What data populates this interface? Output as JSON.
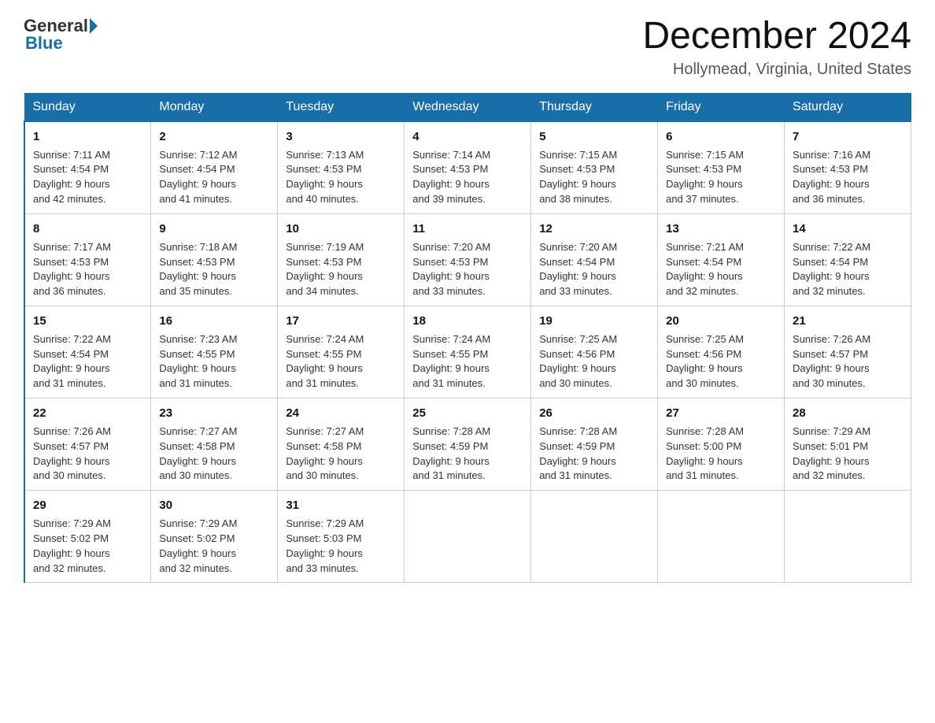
{
  "header": {
    "logo_general": "General",
    "logo_blue": "Blue",
    "month_title": "December 2024",
    "location": "Hollymead, Virginia, United States"
  },
  "days_of_week": [
    "Sunday",
    "Monday",
    "Tuesday",
    "Wednesday",
    "Thursday",
    "Friday",
    "Saturday"
  ],
  "weeks": [
    [
      {
        "day": "1",
        "sunrise": "7:11 AM",
        "sunset": "4:54 PM",
        "daylight": "9 hours and 42 minutes."
      },
      {
        "day": "2",
        "sunrise": "7:12 AM",
        "sunset": "4:54 PM",
        "daylight": "9 hours and 41 minutes."
      },
      {
        "day": "3",
        "sunrise": "7:13 AM",
        "sunset": "4:53 PM",
        "daylight": "9 hours and 40 minutes."
      },
      {
        "day": "4",
        "sunrise": "7:14 AM",
        "sunset": "4:53 PM",
        "daylight": "9 hours and 39 minutes."
      },
      {
        "day": "5",
        "sunrise": "7:15 AM",
        "sunset": "4:53 PM",
        "daylight": "9 hours and 38 minutes."
      },
      {
        "day": "6",
        "sunrise": "7:15 AM",
        "sunset": "4:53 PM",
        "daylight": "9 hours and 37 minutes."
      },
      {
        "day": "7",
        "sunrise": "7:16 AM",
        "sunset": "4:53 PM",
        "daylight": "9 hours and 36 minutes."
      }
    ],
    [
      {
        "day": "8",
        "sunrise": "7:17 AM",
        "sunset": "4:53 PM",
        "daylight": "9 hours and 36 minutes."
      },
      {
        "day": "9",
        "sunrise": "7:18 AM",
        "sunset": "4:53 PM",
        "daylight": "9 hours and 35 minutes."
      },
      {
        "day": "10",
        "sunrise": "7:19 AM",
        "sunset": "4:53 PM",
        "daylight": "9 hours and 34 minutes."
      },
      {
        "day": "11",
        "sunrise": "7:20 AM",
        "sunset": "4:53 PM",
        "daylight": "9 hours and 33 minutes."
      },
      {
        "day": "12",
        "sunrise": "7:20 AM",
        "sunset": "4:54 PM",
        "daylight": "9 hours and 33 minutes."
      },
      {
        "day": "13",
        "sunrise": "7:21 AM",
        "sunset": "4:54 PM",
        "daylight": "9 hours and 32 minutes."
      },
      {
        "day": "14",
        "sunrise": "7:22 AM",
        "sunset": "4:54 PM",
        "daylight": "9 hours and 32 minutes."
      }
    ],
    [
      {
        "day": "15",
        "sunrise": "7:22 AM",
        "sunset": "4:54 PM",
        "daylight": "9 hours and 31 minutes."
      },
      {
        "day": "16",
        "sunrise": "7:23 AM",
        "sunset": "4:55 PM",
        "daylight": "9 hours and 31 minutes."
      },
      {
        "day": "17",
        "sunrise": "7:24 AM",
        "sunset": "4:55 PM",
        "daylight": "9 hours and 31 minutes."
      },
      {
        "day": "18",
        "sunrise": "7:24 AM",
        "sunset": "4:55 PM",
        "daylight": "9 hours and 31 minutes."
      },
      {
        "day": "19",
        "sunrise": "7:25 AM",
        "sunset": "4:56 PM",
        "daylight": "9 hours and 30 minutes."
      },
      {
        "day": "20",
        "sunrise": "7:25 AM",
        "sunset": "4:56 PM",
        "daylight": "9 hours and 30 minutes."
      },
      {
        "day": "21",
        "sunrise": "7:26 AM",
        "sunset": "4:57 PM",
        "daylight": "9 hours and 30 minutes."
      }
    ],
    [
      {
        "day": "22",
        "sunrise": "7:26 AM",
        "sunset": "4:57 PM",
        "daylight": "9 hours and 30 minutes."
      },
      {
        "day": "23",
        "sunrise": "7:27 AM",
        "sunset": "4:58 PM",
        "daylight": "9 hours and 30 minutes."
      },
      {
        "day": "24",
        "sunrise": "7:27 AM",
        "sunset": "4:58 PM",
        "daylight": "9 hours and 30 minutes."
      },
      {
        "day": "25",
        "sunrise": "7:28 AM",
        "sunset": "4:59 PM",
        "daylight": "9 hours and 31 minutes."
      },
      {
        "day": "26",
        "sunrise": "7:28 AM",
        "sunset": "4:59 PM",
        "daylight": "9 hours and 31 minutes."
      },
      {
        "day": "27",
        "sunrise": "7:28 AM",
        "sunset": "5:00 PM",
        "daylight": "9 hours and 31 minutes."
      },
      {
        "day": "28",
        "sunrise": "7:29 AM",
        "sunset": "5:01 PM",
        "daylight": "9 hours and 32 minutes."
      }
    ],
    [
      {
        "day": "29",
        "sunrise": "7:29 AM",
        "sunset": "5:02 PM",
        "daylight": "9 hours and 32 minutes."
      },
      {
        "day": "30",
        "sunrise": "7:29 AM",
        "sunset": "5:02 PM",
        "daylight": "9 hours and 32 minutes."
      },
      {
        "day": "31",
        "sunrise": "7:29 AM",
        "sunset": "5:03 PM",
        "daylight": "9 hours and 33 minutes."
      },
      null,
      null,
      null,
      null
    ]
  ],
  "labels": {
    "sunrise": "Sunrise:",
    "sunset": "Sunset:",
    "daylight": "Daylight:"
  }
}
